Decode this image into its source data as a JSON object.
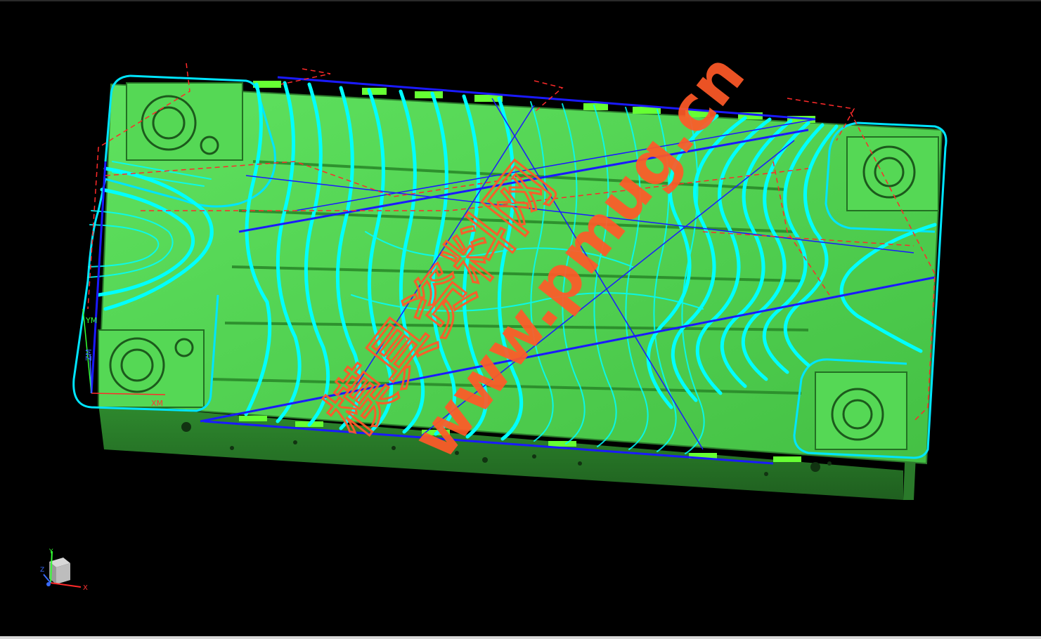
{
  "viewport": {
    "background": "#000000",
    "part_color": "#4fd44f",
    "part_shadow": "#2f8f2f",
    "toolpath_color": "#00ffff",
    "rapid_color": "#ff2a2a",
    "engage_color": "#1a1aff"
  },
  "mcs": {
    "x_label": "XM",
    "y_label": "YM",
    "z_label": "ZM"
  },
  "triad": {
    "x_label": "X",
    "y_label": "Y",
    "z_label": "Z"
  },
  "watermark": {
    "url": "www.pmug.cn",
    "chinese": "模具资料网",
    "color": "#ff5a28"
  }
}
